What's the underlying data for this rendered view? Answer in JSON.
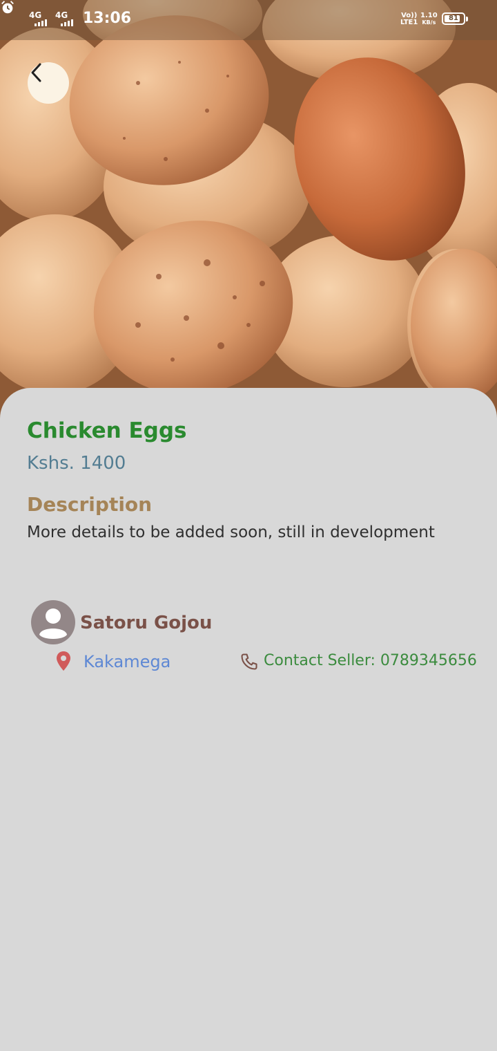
{
  "status_bar": {
    "network_1": "4G",
    "network_2": "4G",
    "time": "13:06",
    "volte_line1": "Vo))",
    "volte_line2": "LTE1",
    "speed_value": "1.10",
    "speed_unit": "KB/s",
    "battery": "81",
    "alarm_icon": "alarm-clock-icon"
  },
  "header": {
    "back_icon": "chevron-left-icon"
  },
  "product": {
    "name": "Chicken Eggs",
    "price": "Kshs. 1400",
    "description_heading": "Description",
    "description": "More details to be added soon, still in development"
  },
  "seller": {
    "name": "Satoru Gojou",
    "avatar_icon": "person-icon",
    "location": "Kakamega",
    "location_icon": "location-pin-icon",
    "contact": "Contact Seller: 0789345656",
    "phone_icon": "phone-icon"
  },
  "colors": {
    "background": "#d8d8d8",
    "title": "#2a8a2f",
    "price": "#537d92",
    "description_heading": "#a58457",
    "seller_name": "#7a5148",
    "location": "#5e88d4",
    "contact": "#3b8b3e",
    "pin": "#d05a5a"
  }
}
